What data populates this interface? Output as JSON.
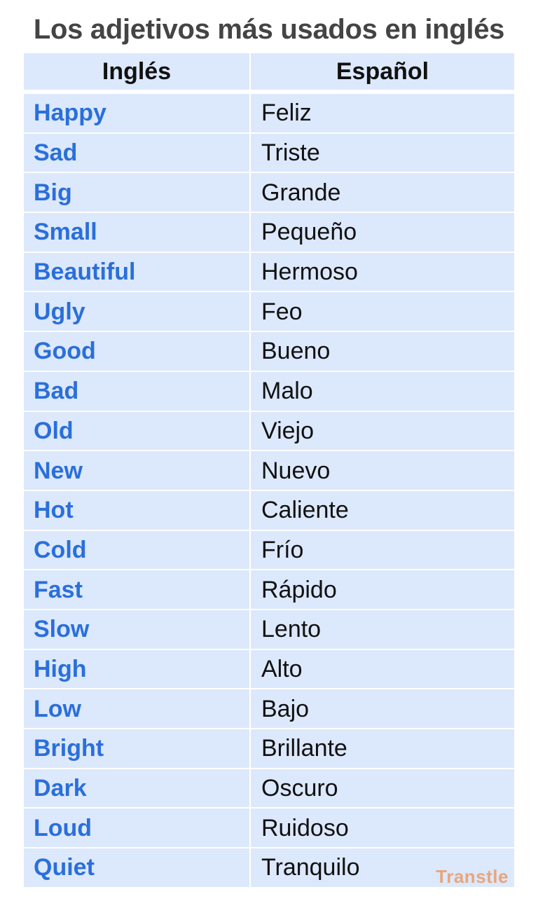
{
  "title": "Los adjetivos más usados en inglés",
  "table": {
    "headers": [
      "Inglés",
      "Español"
    ],
    "rows": [
      {
        "en": "Happy",
        "es": "Feliz"
      },
      {
        "en": "Sad",
        "es": "Triste"
      },
      {
        "en": "Big",
        "es": "Grande"
      },
      {
        "en": "Small",
        "es": "Pequeño"
      },
      {
        "en": "Beautiful",
        "es": "Hermoso"
      },
      {
        "en": "Ugly",
        "es": "Feo"
      },
      {
        "en": "Good",
        "es": "Bueno"
      },
      {
        "en": "Bad",
        "es": "Malo"
      },
      {
        "en": "Old",
        "es": "Viejo"
      },
      {
        "en": "New",
        "es": "Nuevo"
      },
      {
        "en": "Hot",
        "es": "Caliente"
      },
      {
        "en": "Cold",
        "es": "Frío"
      },
      {
        "en": "Fast",
        "es": "Rápido"
      },
      {
        "en": "Slow",
        "es": "Lento"
      },
      {
        "en": "High",
        "es": "Alto"
      },
      {
        "en": "Low",
        "es": "Bajo"
      },
      {
        "en": "Bright",
        "es": "Brillante"
      },
      {
        "en": "Dark",
        "es": "Oscuro"
      },
      {
        "en": "Loud",
        "es": "Ruidoso"
      },
      {
        "en": "Quiet",
        "es": "Tranquilo"
      }
    ]
  },
  "watermark": "Transtle",
  "colors": {
    "cell_background": "#dce8fb",
    "english_text": "#2a6fdb",
    "spanish_text": "#111111",
    "title_text": "#444444",
    "watermark_text": "#e8a67c"
  }
}
